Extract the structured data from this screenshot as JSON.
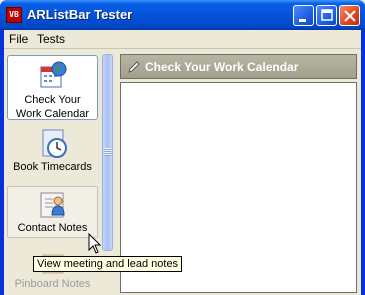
{
  "window": {
    "title": "ARListBar Tester",
    "app_icon_text": "VB"
  },
  "menu": {
    "items": [
      {
        "label": "File"
      },
      {
        "label": "Tests"
      }
    ]
  },
  "listbar": {
    "items": [
      {
        "label_line1": "Check Your",
        "label_line2": "Work Calendar",
        "icon": "calendar-globe-icon",
        "state": "selected"
      },
      {
        "label_line1": "Book Timecards",
        "icon": "clock-icon",
        "state": "normal"
      },
      {
        "label_line1": "Contact Notes",
        "icon": "contact-notes-icon",
        "state": "hover"
      },
      {
        "label_line1": "Pinboard Notes",
        "icon": "pinboard-icon",
        "state": "partially-visible"
      }
    ]
  },
  "content": {
    "header_title": "Check Your Work Calendar",
    "header_icon": "pencil-icon"
  },
  "tooltip": {
    "text": "View meeting and lead notes"
  },
  "colors": {
    "titlebar": "#0553d9",
    "header_bg": "#a29f8d",
    "selected_border": "#7f9db9"
  }
}
